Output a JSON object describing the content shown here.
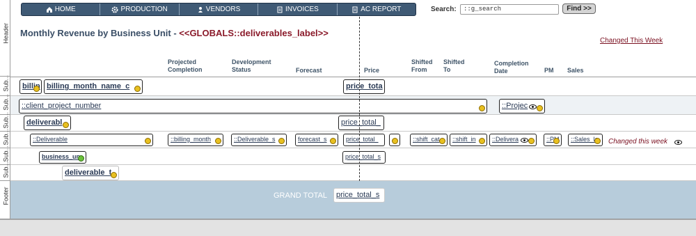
{
  "nav": {
    "items": [
      {
        "label": "HOME",
        "icon": "home-icon"
      },
      {
        "label": "PRODUCTION",
        "icon": "gear-icon"
      },
      {
        "label": "VENDORS",
        "icon": "person-icon"
      },
      {
        "label": "INVOICES",
        "icon": "document-icon"
      },
      {
        "label": "AC REPORT",
        "icon": "document-icon"
      }
    ]
  },
  "search": {
    "label": "Search:",
    "value": "::g_search",
    "button": "Find >>"
  },
  "header": {
    "title_prefix": "Monthly Revenue by Business Unit - ",
    "title_global": "<<GLOBALS::deliverables_label>>",
    "changed_link": "Changed This Week"
  },
  "columns": {
    "projected_completion": "Projected Completion",
    "development_status": "Development Status",
    "forecast": "Forecast",
    "price": "Price",
    "shifted_from": "Shifted From",
    "shifted_to": "Shifted To",
    "completion_date": "Completion Date",
    "pm": "PM",
    "sales": "Sales"
  },
  "left_tabs": {
    "header": "Header",
    "sub": "Sub...",
    "footer": "Footer"
  },
  "fields": {
    "row1_a": "billin",
    "row1_b": "billing_month_name_c",
    "row1_price": "price_tota",
    "row2_a": "::client_project_number",
    "row2_b": "::Projec",
    "row3_a": "deliverabl",
    "row3_price": "price_total_",
    "row4_deliverable": "::Deliverable",
    "row4_billing": "::billing_month",
    "row4_status": "::Deliverable_s",
    "row4_forecast": "forecast_s",
    "row4_price": "price_total_",
    "row4_shift1": "::shift_cat",
    "row4_shift2": "::shift_in",
    "row4_delivery": "::Delivera",
    "row4_pm": "::PM",
    "row4_sales": "::Sales_la",
    "row4_changed": "Changed this week",
    "row5_a": "business_un",
    "row5_price": "price_total_s",
    "row6_a": "deliverable_t"
  },
  "footer": {
    "label": "GRAND TOTAL",
    "value": "price_total_s"
  }
}
